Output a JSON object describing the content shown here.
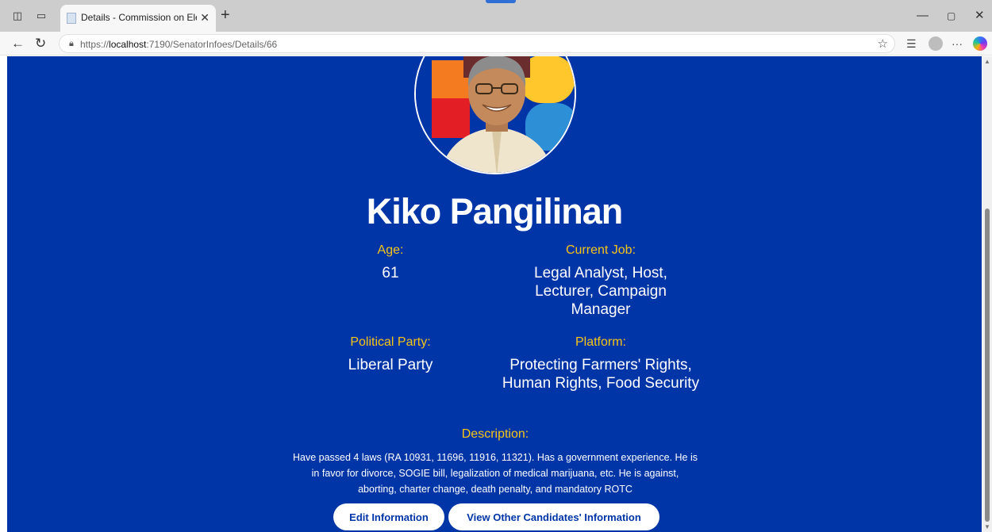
{
  "browser": {
    "tab_title": "Details - Commission on Elections",
    "url_prefix": "https://",
    "url_host": "localhost",
    "url_path": ":7190/SenatorInfoes/Details/66",
    "icons": {
      "workspaces": "workspaces-icon",
      "tab_actions": "tab-actions-icon",
      "close_tab": "close-icon",
      "new_tab": "plus-icon",
      "back": "back-arrow-icon",
      "refresh": "refresh-icon",
      "lock": "lock-icon",
      "favorite": "star-icon",
      "favorites_bar": "favorites-icon",
      "profile": "profile-icon",
      "more": "more-icon",
      "copilot": "copilot-icon"
    }
  },
  "candidate": {
    "name": "Kiko Pangilinan",
    "age_label": "Age:",
    "age": "61",
    "job_label": "Current Job:",
    "job": "Legal Analyst, Host, Lecturer, Campaign Manager",
    "party_label": "Political Party:",
    "party": "Liberal Party",
    "platform_label": "Platform:",
    "platform": "Protecting Farmers' Rights, Human Rights, Food Security",
    "description_label": "Description:",
    "description": "Have passed 4 laws (RA 10931, 11696, 11916, 11321). Has a government experience. He is in favor for divorce, SOGIE bill, legalization of medical marijuana, etc. He is against, aborting, charter change, death penalty, and mandatory ROTC"
  },
  "buttons": {
    "edit": "Edit Information",
    "view_others": "View Other Candidates' Information"
  },
  "colors": {
    "page_background": "#0035a8",
    "label_accent": "#f5c518",
    "text": "#ffffff",
    "button_bg": "#ffffff",
    "button_text": "#0035a8"
  }
}
